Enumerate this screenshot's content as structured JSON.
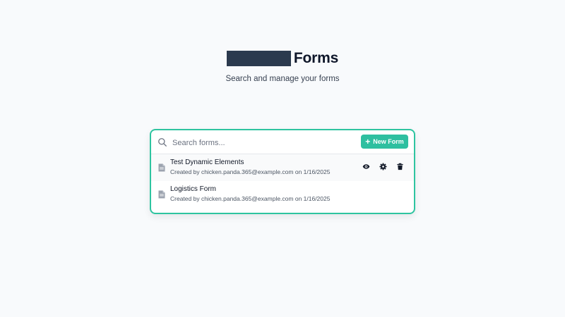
{
  "header": {
    "title": "Forms",
    "subtitle": "Search and manage your forms"
  },
  "search": {
    "placeholder": "Search forms...",
    "icon": "search-icon"
  },
  "toolbar": {
    "new_form_label": "New Form"
  },
  "forms": [
    {
      "name": "Test Dynamic Elements",
      "meta": "Created by chicken.panda.365@example.com on 1/16/2025",
      "icon": "document-icon",
      "actions": [
        "view-icon",
        "settings-icon",
        "delete-icon"
      ]
    },
    {
      "name": "Logistics Form",
      "meta": "Created by chicken.panda.365@example.com on 1/16/2025",
      "icon": "document-icon"
    }
  ],
  "colors": {
    "accent": "#2ebfa0",
    "border": "#2ec4a0",
    "background": "#f8fafc",
    "redaction": "#2b3a4e"
  }
}
